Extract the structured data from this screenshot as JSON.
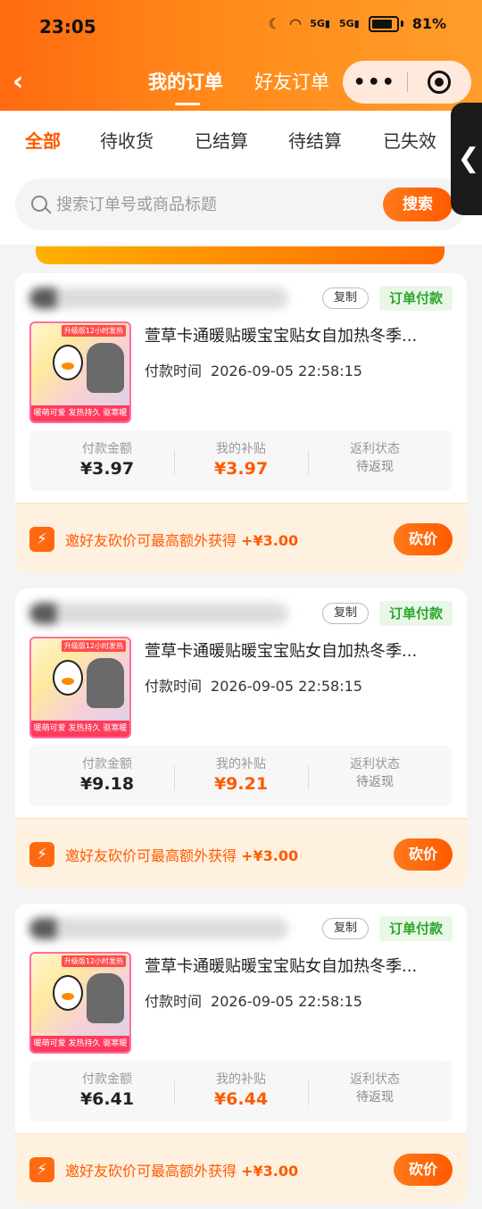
{
  "status": {
    "time": "23:05",
    "net1": "5G",
    "net2": "5G",
    "battery": "81%"
  },
  "nav": {
    "back": "‹",
    "tabs": [
      {
        "label": "我的订单"
      },
      {
        "label": "好友订单"
      }
    ],
    "capsule_more": "•••"
  },
  "filters": {
    "tabs": [
      {
        "label": "全部"
      },
      {
        "label": "待收货"
      },
      {
        "label": "已结算"
      },
      {
        "label": "待结算"
      },
      {
        "label": "已失效"
      }
    ]
  },
  "search": {
    "placeholder": "搜索订单号或商品标题",
    "button": "搜索"
  },
  "side_handle": "❮",
  "orders": [
    {
      "copy": "复制",
      "status": "订单付款",
      "title": "萱草卡通暖贴暖宝宝贴女自加热冬季...",
      "pay_time_label": "付款时间",
      "pay_time": "2026-09-05 22:58:15",
      "pay_amount_label": "付款金额",
      "pay_amount": "¥3.97",
      "subsidy_label": "我的补贴",
      "subsidy": "¥3.97",
      "rebate_label": "返利状态",
      "rebate": "待返现",
      "promo": "邀好友砍价可最高额外获得",
      "promo_amount": "+¥3.00",
      "bargain": "砍价"
    },
    {
      "copy": "复制",
      "status": "订单付款",
      "title": "萱草卡通暖贴暖宝宝贴女自加热冬季...",
      "pay_time_label": "付款时间",
      "pay_time": "2026-09-05 22:58:15",
      "pay_amount_label": "付款金额",
      "pay_amount": "¥9.18",
      "subsidy_label": "我的补贴",
      "subsidy": "¥9.21",
      "rebate_label": "返利状态",
      "rebate": "待返现",
      "promo": "邀好友砍价可最高额外获得",
      "promo_amount": "+¥3.00",
      "bargain": "砍价"
    },
    {
      "copy": "复制",
      "status": "订单付款",
      "title": "萱草卡通暖贴暖宝宝贴女自加热冬季...",
      "pay_time_label": "付款时间",
      "pay_time": "2026-09-05 22:58:15",
      "pay_amount_label": "付款金额",
      "pay_amount": "¥6.41",
      "subsidy_label": "我的补贴",
      "subsidy": "¥6.44",
      "rebate_label": "返利状态",
      "rebate": "待返现",
      "promo": "邀好友砍价可最高额外获得",
      "promo_amount": "+¥3.00",
      "bargain": "砍价"
    }
  ],
  "thumb": {
    "tag": "升级版12小时发热",
    "strip": "暖萌可爱 发热持久 驱寒暖身"
  }
}
